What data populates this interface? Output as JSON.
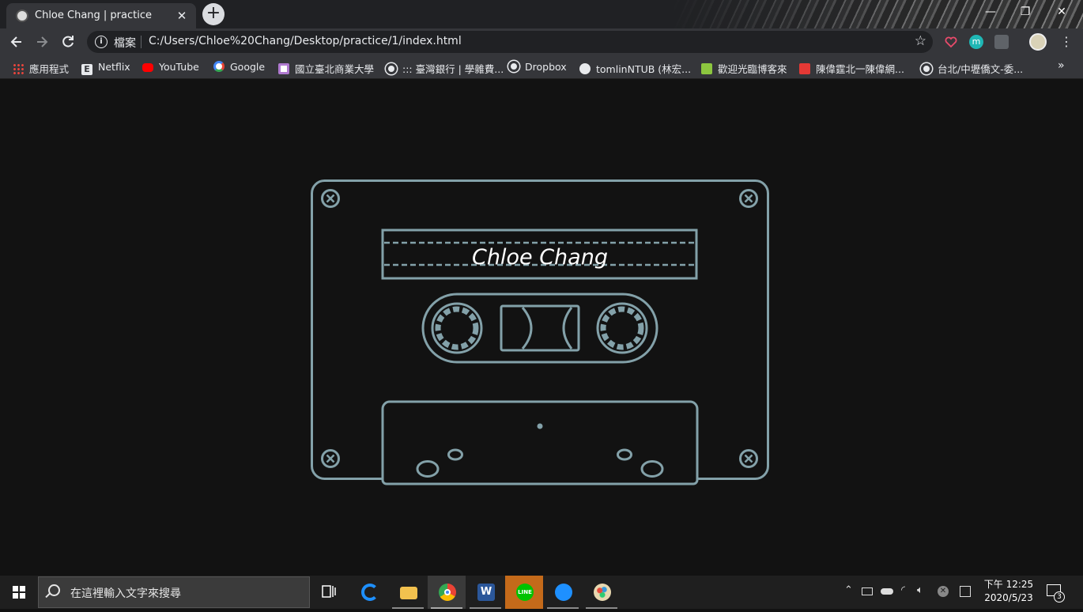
{
  "browser": {
    "tab_title": "Chloe Chang | practice",
    "tab_close": "✕",
    "new_tab": "+",
    "window_controls": {
      "minimize": "—",
      "restore": "❐",
      "close": "✕"
    },
    "address_scheme_label": "檔案",
    "address_url": "C:/Users/Chloe%20Chang/Desktop/practice/1/index.html",
    "extension_m_label": "m"
  },
  "bookmarks": [
    {
      "label": "應用程式",
      "icon": "apps-grid-icon",
      "color": "#e8453c"
    },
    {
      "label": "Netflix",
      "icon": "netflix-icon",
      "color": "#e8eaed"
    },
    {
      "label": "YouTube",
      "icon": "youtube-icon",
      "color": "#ff0000"
    },
    {
      "label": "Google",
      "icon": "google-icon",
      "color": "#ffffff"
    },
    {
      "label": "國立臺北商業大學",
      "icon": "school-icon",
      "color": "#b07ad0"
    },
    {
      "label": "::: 臺灣銀行 | 學雜費...",
      "icon": "globe-icon",
      "color": "#e8eaed"
    },
    {
      "label": "Dropbox",
      "icon": "globe-icon",
      "color": "#e8eaed"
    },
    {
      "label": "tomlinNTUB (林宏...",
      "icon": "github-icon",
      "color": "#e8eaed"
    },
    {
      "label": "歡迎光臨博客來",
      "icon": "bookstore-icon",
      "color": "#8cc63f"
    },
    {
      "label": "陳偉霆北一陳偉網...",
      "icon": "red-square-icon",
      "color": "#e53935"
    },
    {
      "label": "台北/中壢僑文-委...",
      "icon": "globe-icon",
      "color": "#e8eaed"
    }
  ],
  "bookmarks_overflow": "»",
  "cassette": {
    "label_text": "Chloe Chang",
    "stroke_color": "#83a1a9",
    "background_color": "#121212"
  },
  "taskbar": {
    "search_placeholder": "在這裡輸入文字來搜尋",
    "clock_time": "下午 12:25",
    "clock_date": "2020/5/23",
    "notification_count": "3",
    "apps": [
      "task-view",
      "edge",
      "file-explorer",
      "chrome",
      "word",
      "line",
      "app-blue",
      "paint"
    ]
  }
}
